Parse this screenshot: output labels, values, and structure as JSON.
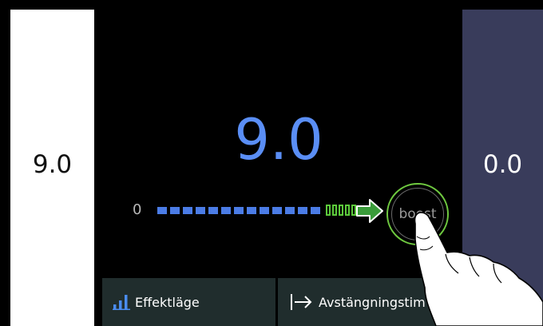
{
  "left_zone": {
    "value": "9.0"
  },
  "right_zone": {
    "value": "0.0"
  },
  "main": {
    "value": "9.0",
    "scale_min": "0",
    "boost_label": "boost"
  },
  "bottom_buttons": [
    {
      "label": "Effektläge",
      "icon": "bar-chart-icon"
    },
    {
      "label": "Avstängningstim",
      "icon": "arrow-to-bar-icon"
    }
  ],
  "colors": {
    "accent_blue": "#5a8ef5",
    "boost_green": "#6fc940",
    "right_panel": "#393c5b",
    "bottom_button_bg": "#202d2d"
  }
}
